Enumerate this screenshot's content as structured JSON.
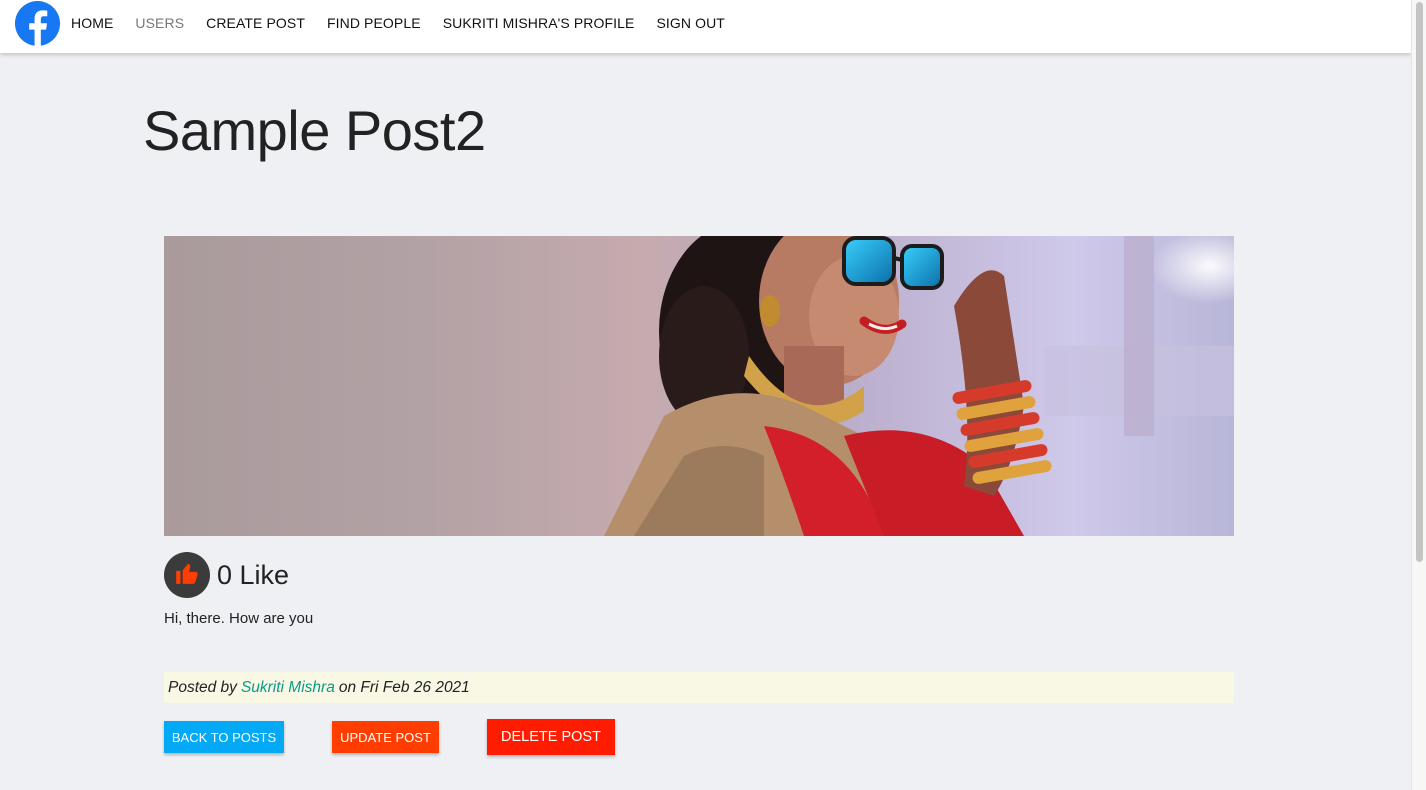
{
  "nav": {
    "logo_icon": "facebook-icon",
    "links": [
      {
        "label": "HOME"
      },
      {
        "label": "USERS",
        "active": true
      },
      {
        "label": "CREATE POST"
      },
      {
        "label": "FIND PEOPLE"
      },
      {
        "label": "SUKRITI MISHRA'S PROFILE"
      },
      {
        "label": "SIGN OUT"
      }
    ]
  },
  "post": {
    "title": "Sample Post2",
    "like_count": "0 Like",
    "like_icon": "thumbs-up-icon",
    "body": "Hi, there. How are you",
    "posted_by_prefix": "Posted by",
    "author": "Sukriti Mishra",
    "date_text": "on Fri Feb 26 2021"
  },
  "buttons": {
    "back": "BACK TO POSTS",
    "update": "UPDATE POST",
    "delete": "DELETE POST"
  },
  "colors": {
    "facebook_blue": "#1877f2",
    "back_button": "#03a9f4",
    "update_button": "#ff3d00",
    "delete_button": "#ff1c00",
    "author_link": "#0b9a8a",
    "posted_by_bg": "#f8f8e4",
    "page_bg": "#eff0f4"
  }
}
